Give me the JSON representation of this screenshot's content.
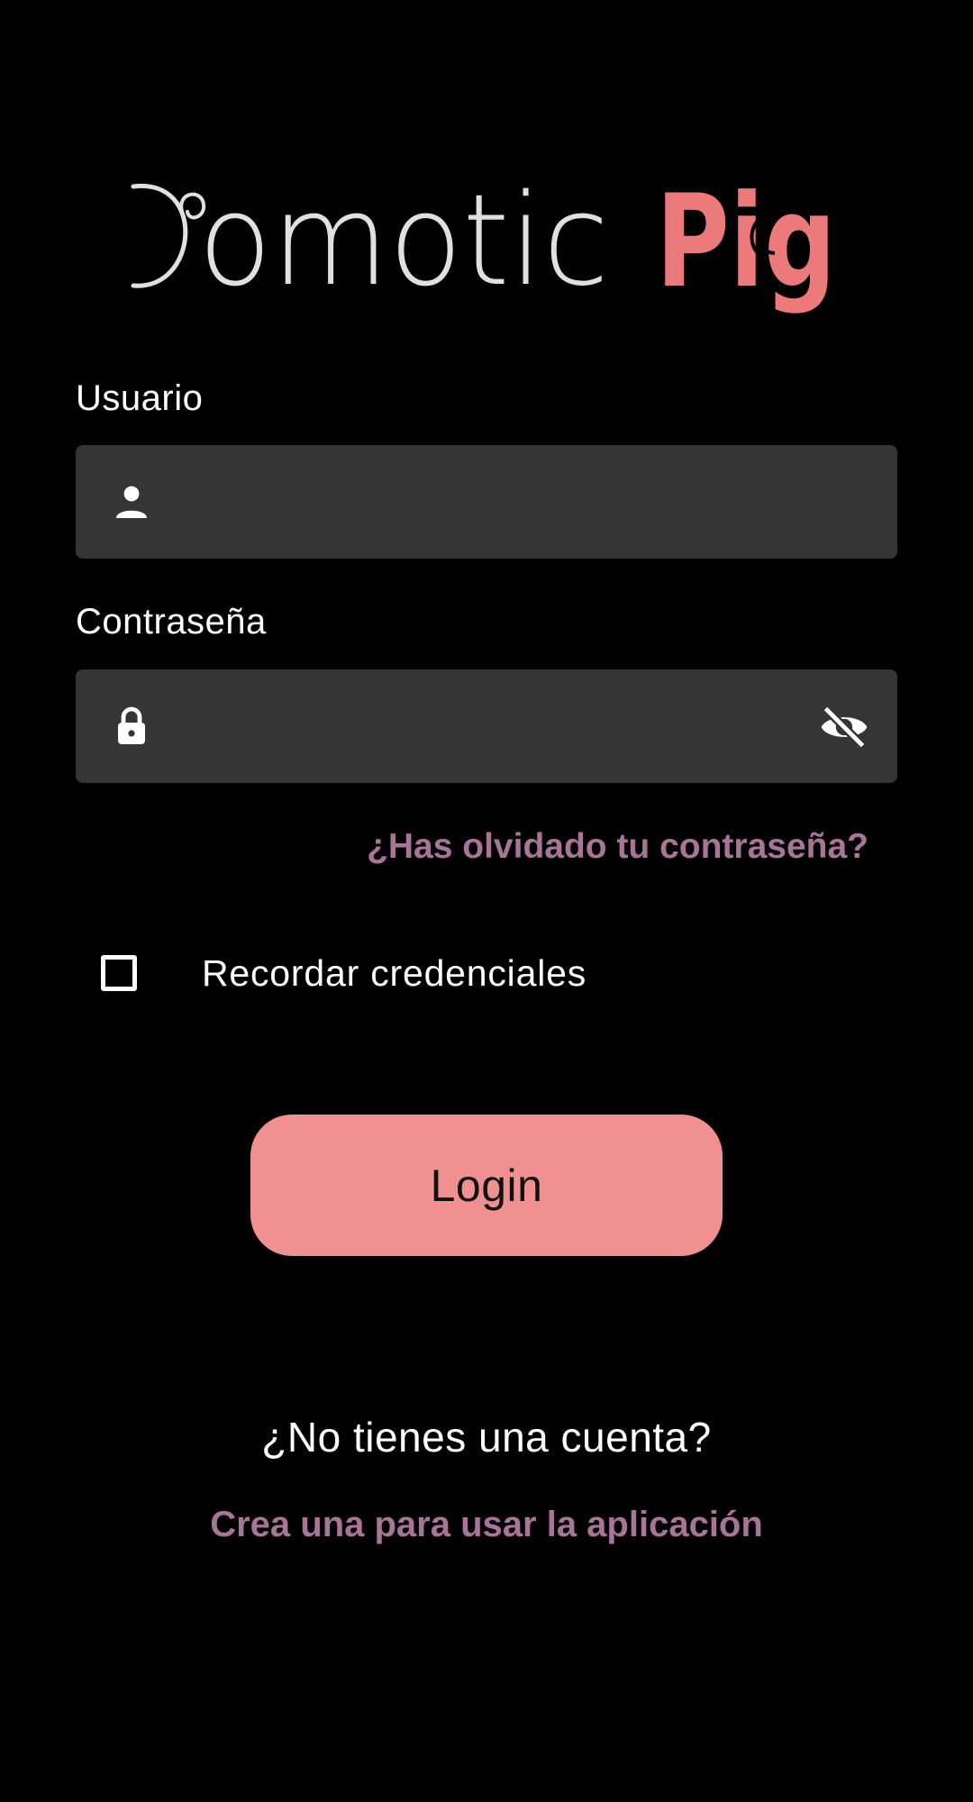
{
  "app": {
    "logo_part1": "DomoticPig",
    "logo_part1_text": "omotic",
    "logo_part2": "Pig",
    "colors": {
      "background": "#000000",
      "input_bg": "#353535",
      "accent_pink": "#f09090",
      "link_purple": "#a87497",
      "logo_light": "#e0e0e0",
      "logo_pink": "#ec7a7a"
    }
  },
  "form": {
    "username": {
      "label": "Usuario",
      "value": "",
      "icon": "person-icon"
    },
    "password": {
      "label": "Contraseña",
      "value": "",
      "icon": "lock-icon",
      "toggle_icon": "eye-off-icon"
    },
    "forgot_password": "¿Has olvidado tu contraseña?",
    "remember": {
      "label": "Recordar credenciales",
      "checked": false
    },
    "login_label": "Login"
  },
  "signup": {
    "prompt": "¿No tienes una cuenta?",
    "link": "Crea una para usar la aplicación"
  }
}
